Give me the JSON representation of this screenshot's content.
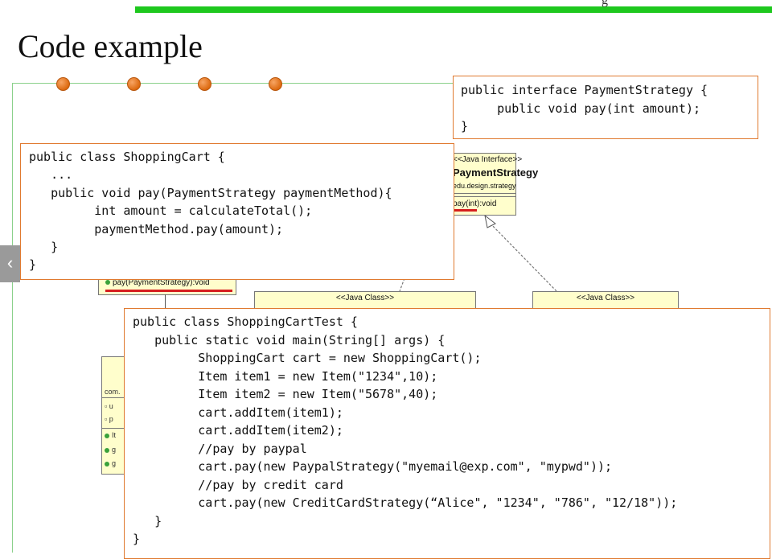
{
  "slide": {
    "title": "Code example",
    "top_glyph": "g",
    "accent_color": "#1ec81e",
    "nav_prev_icon": "‹"
  },
  "uml": {
    "interface_stereotype": "<<Java Interface>>",
    "interface_name": "PaymentStrategy",
    "interface_package": "edu.design.strategy",
    "interface_method": "pay(int):void",
    "cart_method": "pay(PaymentStrategy):void",
    "class_stereotype": "<<Java Class>>",
    "item_package": "com.",
    "item_rows": [
      "u",
      "p",
      "It",
      "g",
      "g"
    ]
  },
  "code": {
    "interface_lines": [
      "public interface PaymentStrategy {",
      "     public void pay(int amount);",
      "}"
    ],
    "cart_lines": [
      "public class ShoppingCart {",
      "   ...",
      "   public void pay(PaymentStrategy paymentMethod){",
      "         int amount = calculateTotal();",
      "         paymentMethod.pay(amount);",
      "   }",
      "}"
    ],
    "test_lines": [
      "public class ShoppingCartTest {",
      "   public static void main(String[] args) {",
      "         ShoppingCart cart = new ShoppingCart();",
      "         Item item1 = new Item(\"1234\",10);",
      "         Item item2 = new Item(\"5678\",40);",
      "         cart.addItem(item1);",
      "         cart.addItem(item2);",
      "         //pay by paypal",
      "         cart.pay(new PaypalStrategy(\"myemail@exp.com\", \"mypwd\"));",
      "         //pay by credit card",
      "         cart.pay(new CreditCardStrategy(“Alice\", \"1234\", \"786\", \"12/18\"));",
      "   }",
      "}"
    ]
  }
}
